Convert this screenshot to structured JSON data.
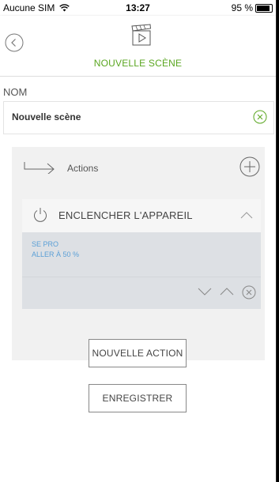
{
  "status_bar": {
    "carrier": "Aucune SIM",
    "time": "13:27",
    "battery": "95 %"
  },
  "header": {
    "title": "NOUVELLE SCÈNE",
    "accent_color": "#5aa620"
  },
  "form": {
    "name_label": "NOM",
    "name_value": "Nouvelle scène"
  },
  "actions": {
    "label": "Actions",
    "items": [
      {
        "title": "ENCLENCHER L'APPAREIL",
        "lines": [
          "SE PRO",
          "ALLER À 50 %"
        ]
      }
    ]
  },
  "buttons": {
    "new_action": "NOUVELLE ACTION",
    "save": "ENREGISTRER"
  },
  "icons": {
    "back": "back-circle-icon",
    "clapper": "clapperboard-play-icon",
    "clear": "clear-circle-icon",
    "arrow": "arrow-right-icon",
    "add": "plus-circle-icon",
    "power": "power-icon",
    "collapse": "chevron-up-icon",
    "move_down": "chevron-down-icon",
    "move_up": "chevron-up-icon",
    "delete": "close-circle-icon",
    "wifi": "wifi-icon",
    "battery": "battery-icon"
  }
}
